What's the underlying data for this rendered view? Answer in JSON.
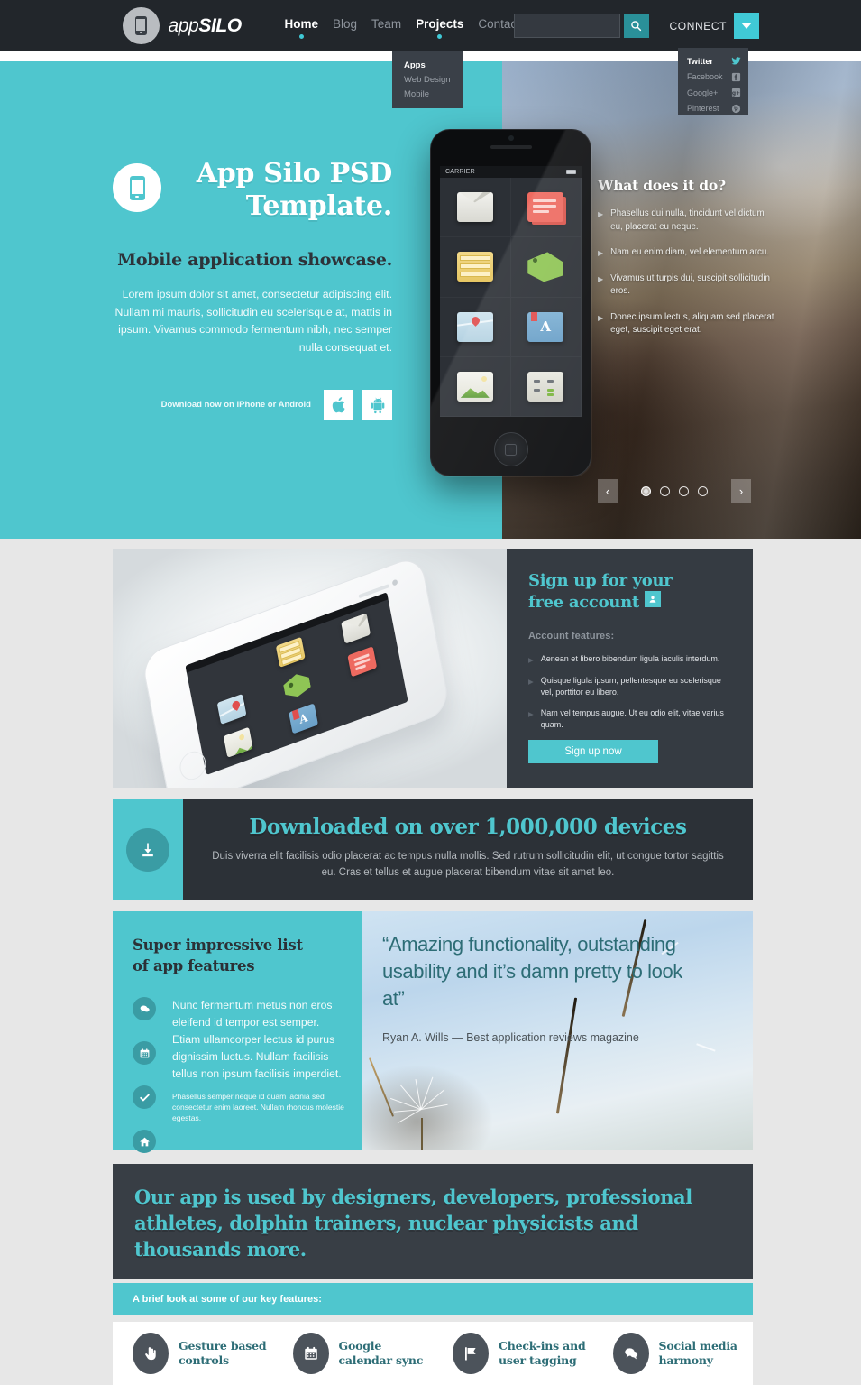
{
  "header": {
    "logo": {
      "text_light": "app",
      "text_bold": "SILO",
      "icon": "phone-icon"
    },
    "nav": [
      {
        "label": "Home",
        "active": true
      },
      {
        "label": "Blog",
        "active": false
      },
      {
        "label": "Team",
        "active": false
      },
      {
        "label": "Projects",
        "active": true
      },
      {
        "label": "Contact",
        "active": false
      }
    ],
    "search": {
      "value": "",
      "placeholder": "",
      "icon": "search-icon"
    },
    "connect": {
      "label": "CONNECT",
      "icon": "chevron-down-icon"
    },
    "projects_dropdown": [
      {
        "label": "Apps",
        "active": true
      },
      {
        "label": "Web Design",
        "active": false
      },
      {
        "label": "Mobile",
        "active": false
      }
    ],
    "connect_dropdown": [
      {
        "label": "Twitter",
        "icon": "twitter-icon",
        "active": true
      },
      {
        "label": "Facebook",
        "icon": "facebook-icon",
        "active": false
      },
      {
        "label": "Google+",
        "icon": "googleplus-icon",
        "active": false
      },
      {
        "label": "Pinterest",
        "icon": "pinterest-icon",
        "active": false
      }
    ]
  },
  "hero": {
    "badge_icon": "phone-icon",
    "title": "App Silo PSD Template.",
    "subtitle": "Mobile application showcase.",
    "paragraph": "Lorem ipsum dolor sit amet, consectetur adipiscing elit. Nullam mi mauris, sollicitudin eu scelerisque at, mattis in ipsum. Vivamus commodo fermentum nibh, nec semper nulla consequat et.",
    "download_text": "Download now on iPhone or Android",
    "download_buttons": [
      {
        "name": "apple-icon"
      },
      {
        "name": "android-icon"
      }
    ],
    "phone": {
      "carrier": "CARRIER",
      "apps": [
        "mail-icon",
        "chat-icon",
        "books-icon",
        "tag-icon",
        "map-icon",
        "dictionary-icon",
        "photos-icon",
        "calculator-icon"
      ]
    },
    "right": {
      "title": "What does it do?",
      "items": [
        "Phasellus dui nulla, tincidunt vel dictum eu, placerat eu neque.",
        "Nam eu enim diam, vel elementum arcu.",
        "Vivamus ut turpis dui, suscipit sollicitudin eros.",
        "Donec ipsum lectus, aliquam sed placerat eget, suscipit eget erat."
      ]
    },
    "carousel": {
      "prev": "‹",
      "next": "›",
      "dots": 4,
      "active_dot": 0
    }
  },
  "signup": {
    "title_line1": "Sign up for your",
    "title_line2": "free account",
    "badge_icon": "user-icon",
    "features_label": "Account features:",
    "features": [
      "Aenean et libero bibendum ligula iaculis interdum.",
      "Quisque ligula ipsum, pellentesque eu scelerisque vel, porttitor eu libero.",
      "Nam vel tempus augue. Ut eu odio elit, vitae varius quam."
    ],
    "button": "Sign up now"
  },
  "download_band": {
    "icon": "download-icon",
    "heading": "Downloaded on over 1,000,000 devices",
    "paragraph": "Duis viverra elit facilisis odio placerat ac tempus nulla mollis. Sed rutrum sollicitudin elit, ut congue tortor sagittis eu. Cras et tellus et augue placerat bibendum vitae sit amet leo."
  },
  "features": {
    "title_line1": "Super impressive list",
    "title_line2": "of app features",
    "icons": [
      "chat-icon",
      "calendar-icon",
      "check-icon",
      "home-icon"
    ],
    "paragraph_large": "Nunc fermentum metus non eros eleifend id tempor est semper. Etiam ullamcorper lectus id purus dignissim luctus. Nullam facilisis tellus non ipsum facilisis imperdiet.",
    "paragraph_small": "Phasellus semper neque id quam lacinia sed consectetur enim laoreet. Nullam rhoncus molestie egestas."
  },
  "quote": {
    "text": "“Amazing functionality, outstanding usability and it’s damn pretty to look at”",
    "author": "Ryan A. Wills — Best application reviews magazine"
  },
  "statement": {
    "text": "Our app is used by designers, developers, professional athletes, dolphin trainers, nuclear physicists and thousands more."
  },
  "brief": {
    "text": "A brief look at some of our key features:"
  },
  "bottom_features": [
    {
      "icon": "gesture-icon",
      "label": "Gesture based controls"
    },
    {
      "icon": "calendar-icon",
      "label": "Google calendar sync"
    },
    {
      "icon": "flag-icon",
      "label": "Check-ins and user tagging"
    },
    {
      "icon": "chat-icon",
      "label": "Social media harmony"
    }
  ],
  "colors": {
    "teal": "#4fc6ce",
    "teal_dark": "#2d6d76",
    "dark": "#353b42",
    "header_dark": "#22262b",
    "page_bg": "#e7e7e7"
  }
}
